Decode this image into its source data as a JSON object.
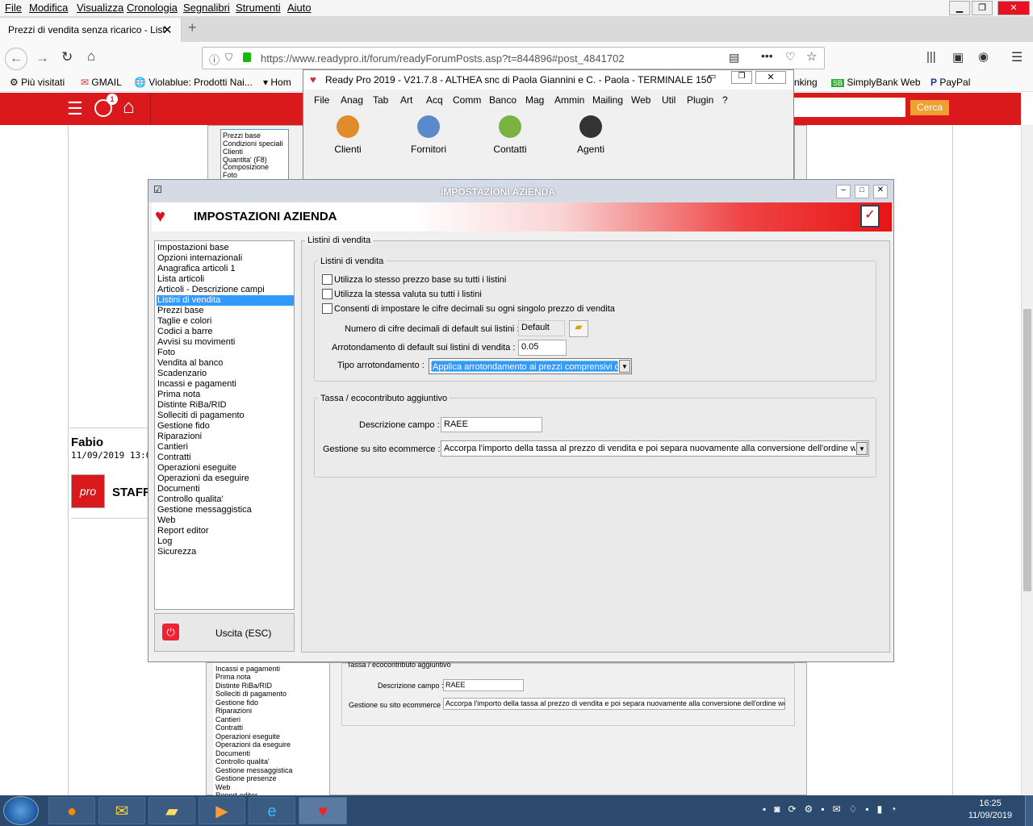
{
  "browser_menu": [
    "File",
    "Modifica",
    "Visualizza",
    "Cronologia",
    "Segnalibri",
    "Strumenti",
    "Aiuto"
  ],
  "tab": {
    "title": "Prezzi di vendita senza ricarico - List",
    "new_tab": "+"
  },
  "url": "https://www.readypro.it/forum/readyForumPosts.asp?t=844896#post_4841702",
  "bookmarks": [
    "Più visitati",
    "GMAIL",
    "Violablue: Prodotti Nai...",
    "Hom",
    "nking",
    "SimplyBank Web",
    "PayPal"
  ],
  "site": {
    "badge": "1",
    "search_button": "Cerca"
  },
  "forum": {
    "author": "Fabio",
    "date": "11/09/2019 13:0",
    "pro_logo": "pro",
    "staff_label": "STAFF"
  },
  "readypro": {
    "title": "Ready Pro 2019 - V21.7.8 - ALTHEA snc di Paola Giannini e C. - Paola - TERMINALE 150",
    "menu": [
      "File",
      "Anag",
      "Tab",
      "Art",
      "Acq",
      "Comm",
      "Banco",
      "Mag",
      "Ammin",
      "Mailing",
      "Web",
      "Util",
      "Plugin",
      "?"
    ],
    "toolbar": [
      "Clienti",
      "Fornitori",
      "Contatti",
      "Agenti"
    ]
  },
  "dialog": {
    "title": "IMPOSTAZIONI AZIENDA",
    "header": "IMPOSTAZIONI AZIENDA",
    "exit_label": "Uscita (ESC)",
    "nav_items": [
      "Impostazioni base",
      "Opzioni internazionali",
      "Anagrafica articoli 1",
      "Lista articoli",
      "Articoli - Descrizione campi",
      "Listini di vendita",
      "Prezzi base",
      "Taglie e colori",
      "Codici a barre",
      "Avvisi su movimenti",
      "Foto",
      "Vendita al banco",
      "Scadenzario",
      "Incassi e pagamenti",
      "Prima nota",
      "Distinte RiBa/RID",
      "Solleciti di pagamento",
      "Gestione fido",
      "Riparazioni",
      "Cantieri",
      "Contratti",
      "Operazioni eseguite",
      "Operazioni da eseguire",
      "Documenti",
      "Controllo qualita'",
      "Gestione messaggistica",
      "Web",
      "Report editor",
      "Log",
      "Sicurezza"
    ],
    "selected_index": 5,
    "panel_title": "Listini di vendita",
    "group1": {
      "title": "Listini di vendita",
      "check1": "Utilizza lo stesso prezzo base su tutti i listini",
      "check2": "Utilizza la stessa valuta su tutti i listini",
      "check3": "Consenti di impostare le cifre decimali su ogni singolo prezzo di vendita",
      "decimals_label": "Numero di cifre decimali di default sui listini :",
      "decimals_value": "Default",
      "rounding_label": "Arrotondamento di default sui listini di vendita :",
      "rounding_value": "0.05",
      "type_label": "Tipo arrotondamento :",
      "type_value": "Applica arrotondamento ai prezzi comprensivi di"
    },
    "group2": {
      "title": "Tassa / ecocontributo aggiuntivo",
      "desc_label": "Descrizione campo :",
      "desc_value": "RAEE",
      "ecom_label": "Gestione su sito ecommerce :",
      "ecom_value": "Accorpa l'importo della tassa al prezzo di vendita e poi separa nuovamente alla conversione dell'ordine web"
    }
  },
  "bg_screenshot": {
    "top_items": [
      "Prezzi base",
      "Condizioni speciali",
      "Clienti",
      "Quantita' (F8)",
      "Composizione",
      "Foto"
    ],
    "bottom_items": [
      "Incassi e pagamenti",
      "Prima nota",
      "Distinte RiBa/RID",
      "Solleciti di pagamento",
      "Gestione fido",
      "Riparazioni",
      "Cantieri",
      "Contratti",
      "Operazioni eseguite",
      "Operazioni da eseguire",
      "Documenti",
      "Controllo qualita'",
      "Gestione messaggistica",
      "Gestione presenze",
      "Web",
      "Report editor"
    ],
    "group_title": "Tassa / ecocontributo aggiuntivo",
    "desc_label": "Descrizione campo :",
    "desc_value": "RAEE",
    "ecom_label": "Gestione su sito ecommerce :",
    "ecom_value": "Accorpa l'importo della tassa al prezzo di vendita e poi separa nuovamente alla conversione dell'ordine web"
  },
  "clock": {
    "time": "16:25",
    "date": "11/09/2019"
  },
  "colors": {
    "brand_red": "#d9191c",
    "selection": "#3399ff",
    "taskbar": "#2b4a6e"
  }
}
